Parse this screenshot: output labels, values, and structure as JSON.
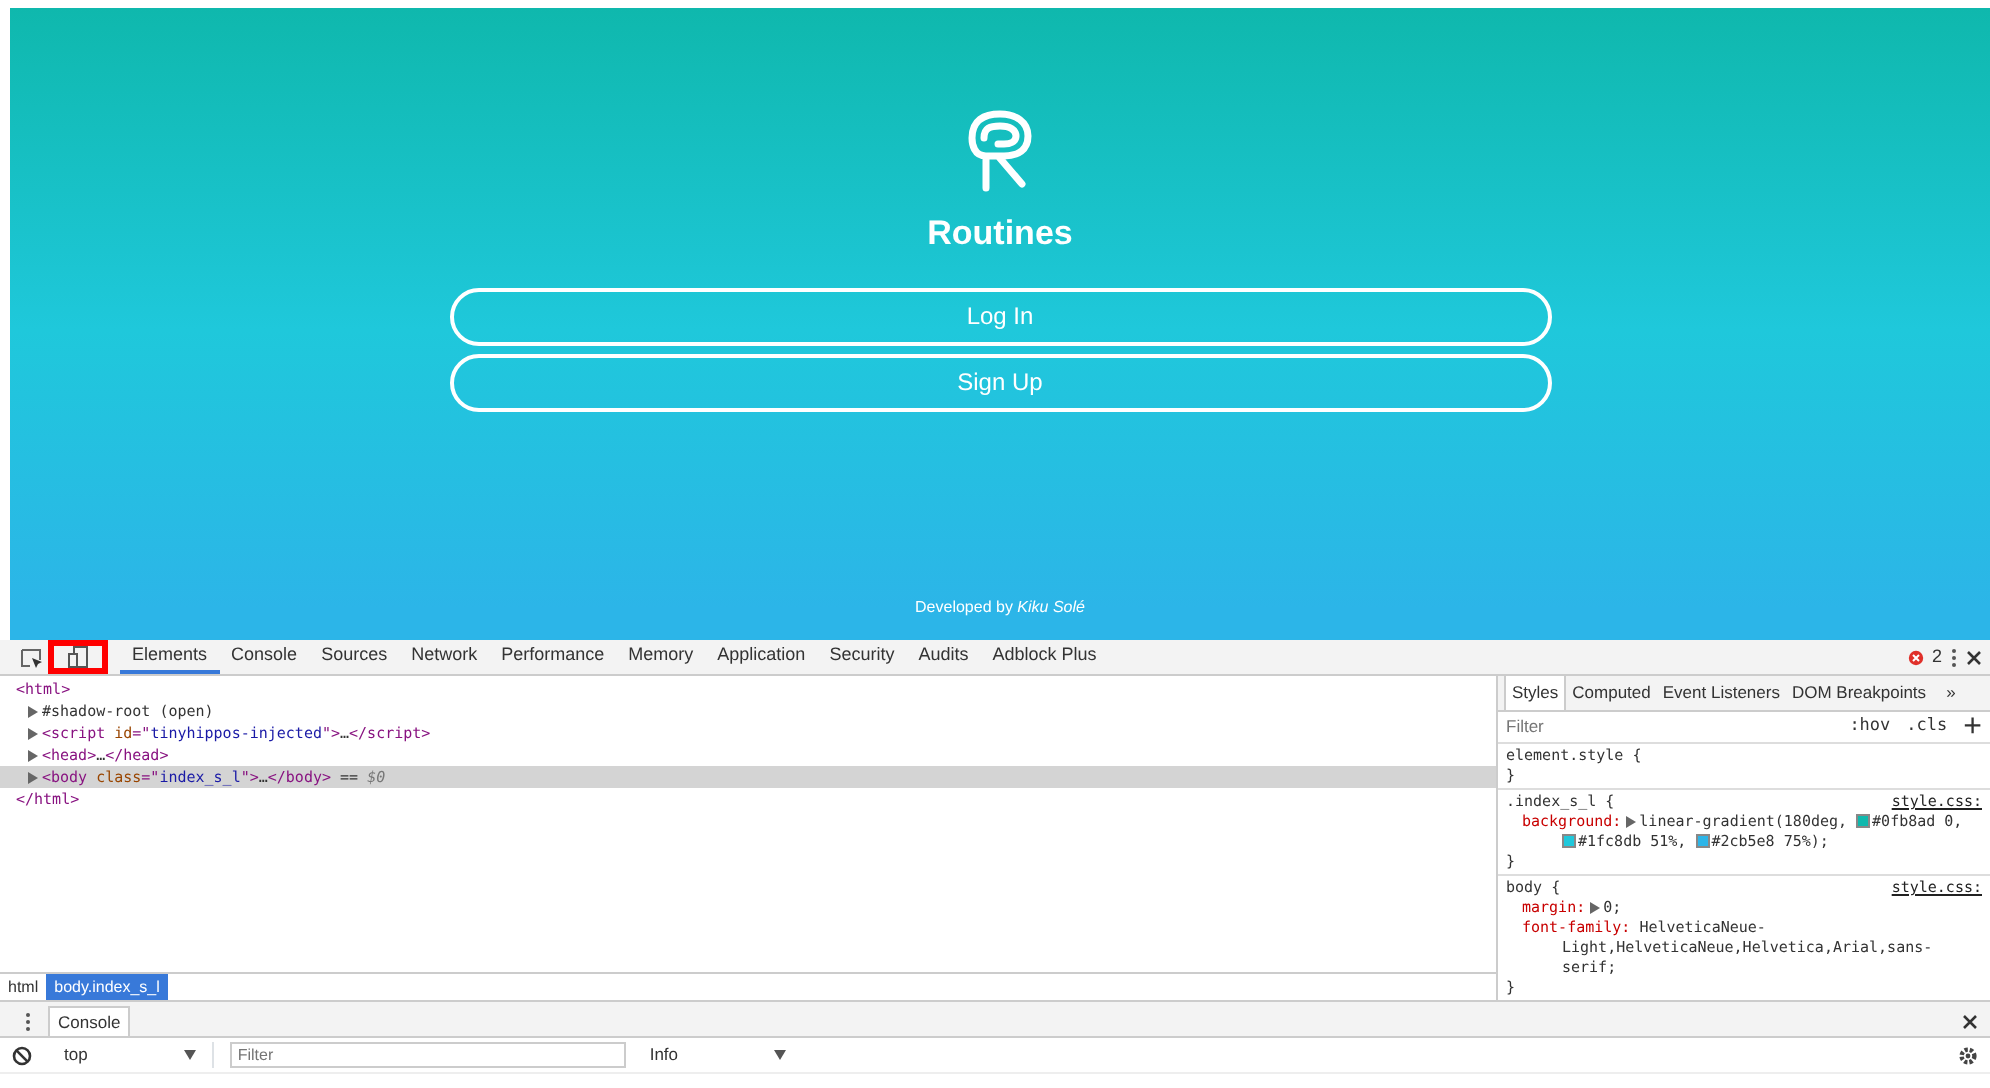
{
  "app": {
    "title": "Routines",
    "buttons": [
      "Log In",
      "Sign Up"
    ],
    "footer": "Developed by *Kiku Solé*"
  },
  "devtools": {
    "tabs": [
      {
        "label": "Elements",
        "selected": true
      },
      {
        "label": "Console",
        "selected": false
      },
      {
        "label": "Sources",
        "selected": false
      },
      {
        "label": "Network",
        "selected": false
      },
      {
        "label": "Performance",
        "selected": false
      },
      {
        "label": "Memory",
        "selected": false
      },
      {
        "label": "Application",
        "selected": false
      },
      {
        "label": "Security",
        "selected": false
      },
      {
        "label": "Audits",
        "selected": false
      },
      {
        "label": "Adblock Plus",
        "selected": false
      }
    ],
    "device_toolbar_highlighted": true,
    "error_count": "2",
    "dom_tree": [
      {
        "parts": [
          {
            "kind": "tag",
            "text": "<html>"
          }
        ],
        "triangle": false,
        "selected": false
      },
      {
        "parts": [
          {
            "kind": "plain",
            "text": "#shadow-root (open)"
          }
        ],
        "triangle": true,
        "selected": false
      },
      {
        "parts": [
          {
            "kind": "tag",
            "text": "<script "
          },
          {
            "kind": "attr",
            "text": "id"
          },
          {
            "kind": "tag",
            "text": "=\""
          },
          {
            "kind": "value",
            "text": "tinyhippos-injected"
          },
          {
            "kind": "tag",
            "text": "\">"
          },
          {
            "kind": "plain",
            "text": "…"
          },
          {
            "kind": "tag",
            "text": "</script>"
          }
        ],
        "triangle": true,
        "selected": false
      },
      {
        "parts": [
          {
            "kind": "tag",
            "text": "<head>"
          },
          {
            "kind": "plain",
            "text": "…"
          },
          {
            "kind": "tag",
            "text": "</head>"
          }
        ],
        "triangle": true,
        "selected": false
      },
      {
        "parts": [
          {
            "kind": "tag",
            "text": "<body "
          },
          {
            "kind": "attr",
            "text": "class"
          },
          {
            "kind": "tag",
            "text": "=\""
          },
          {
            "kind": "value",
            "text": "index_s_l"
          },
          {
            "kind": "tag",
            "text": "\">"
          },
          {
            "kind": "plain",
            "text": "…"
          },
          {
            "kind": "tag",
            "text": "</body>"
          },
          {
            "kind": "plain",
            "text": " == "
          },
          {
            "kind": "ref",
            "text": "$0"
          }
        ],
        "triangle": true,
        "selected": true
      },
      {
        "parts": [
          {
            "kind": "tag",
            "text": "</html>"
          }
        ],
        "triangle": false,
        "selected": false
      }
    ],
    "breadcrumbs": [
      {
        "label": "html",
        "selected": false
      },
      {
        "label": "body.index_s_l",
        "selected": true
      }
    ],
    "side_tabs": [
      {
        "label": "Styles",
        "selected": true
      },
      {
        "label": "Computed",
        "selected": false
      },
      {
        "label": "Event Listeners",
        "selected": false
      },
      {
        "label": "DOM Breakpoints",
        "selected": false
      }
    ],
    "side_more": "»",
    "styles_filter": {
      "placeholder": "Filter",
      "hov": ":hov",
      "cls": ".cls",
      "add": "+"
    },
    "rules": [
      {
        "selector": "element.style {",
        "close": "}"
      },
      {
        "selector": ".index_s_l {",
        "source": "style.css:",
        "close": "}",
        "properties": [
          {
            "name": "background:",
            "expandable": true,
            "segments": [
              {
                "text": "linear-gradient(180deg,"
              },
              {
                "color": "#0fb8ad",
                "text": "#0fb8ad 0,"
              },
              {
                "color": "#1fc8db",
                "text": "#1fc8db 51%,"
              },
              {
                "color": "#2cb5e8",
                "text": "#2cb5e8 75%);"
              }
            ]
          }
        ]
      },
      {
        "selector": "body {",
        "source": "style.css:",
        "close": "}",
        "properties": [
          {
            "name": "margin:",
            "expandable": true,
            "segments": [
              {
                "text": "0;"
              }
            ]
          },
          {
            "name": "font-family:",
            "expandable": false,
            "segments": [
              {
                "text": "HelveticaNeue-"
              },
              {
                "text": "Light,HelveticaNeue,Helvetica,Arial,sans-"
              },
              {
                "text": "serif;"
              }
            ]
          }
        ]
      }
    ],
    "drawer": {
      "tab": "Console",
      "context": "top",
      "filter_placeholder": "Filter",
      "level": "Info"
    }
  }
}
